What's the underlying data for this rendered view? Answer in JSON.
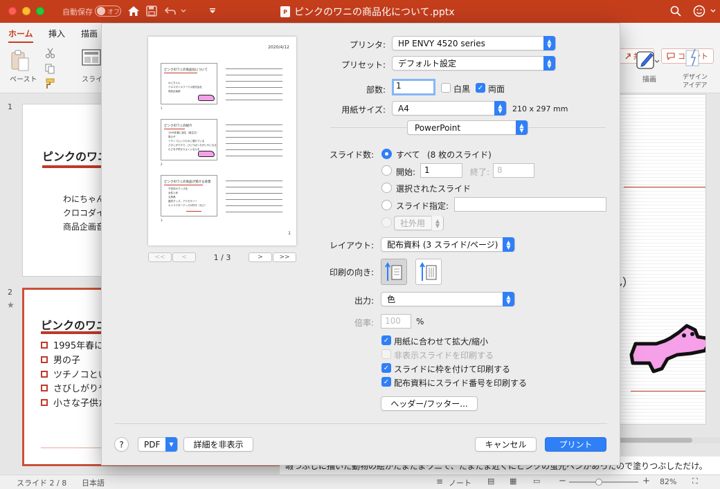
{
  "titlebar": {
    "autosave_label": "自動保存",
    "autosave_state": "オフ",
    "document_title": "ピンクのワニの商品化について.pptx",
    "ppt_badge": "P"
  },
  "ribbon": {
    "tabs": [
      "ホーム",
      "挿入",
      "描画"
    ],
    "share_label": "共有",
    "comment_label": "コメント",
    "paste_label": "ペースト",
    "slide_label": "スライ",
    "draw_label": "描画",
    "design_label_1": "デザイン",
    "design_label_2": "アイデア"
  },
  "thumbnails": {
    "slide1": {
      "number": "1",
      "title": "ピンクのワニ",
      "lines": [
        "わにちゃん",
        "クロコダイ",
        "商品企画音"
      ]
    },
    "slide2": {
      "number": "2",
      "title": "ピンクのワニ",
      "bullets": [
        "1995年春に",
        "男の子",
        "ツチノコとい",
        "さびしがりや",
        "小さな子供た"
      ]
    }
  },
  "mainslide": {
    "partial_text": "ん）"
  },
  "notes": "暇つぶしに描いた動物の絵がたまたまワニで、たまたま近くにピンクの蛍光ペンがあったので塗りつぶしただけ。",
  "status": {
    "slide_counter": "スライド 2 / 8",
    "language": "日本語",
    "notes_label": "ノート",
    "zoom": "82%"
  },
  "preview": {
    "date": "2020/4/12",
    "page_number": "1",
    "page_indicator": "1 / 3",
    "slides": [
      {
        "title": "ピンクのワニの商品化について",
        "lines": [
          "わにちゃん",
          "クロコダイルワークス株式会社",
          "商品企画部"
        ],
        "num": "1"
      },
      {
        "title": "ピンクのワニの紹介",
        "lines": [
          "1995年春に誕生（誕生日）",
          "男の子",
          "ツチノコというものに憧れている",
          "さびしがりやで、ひとりぼっちがいやになる",
          "小さな子供からよくいるんを"
        ],
        "num": "2"
      },
      {
        "title": "ピンクのワニの商品が受ける背景",
        "lines": [
          "子供向けグッズ化",
          "女性人気",
          "文房具",
          "雑貨グッズ、アクセサリー",
          "キャラクターグッズが好き（など）"
        ],
        "num": "3"
      }
    ],
    "nav": {
      "first": "<<",
      "prev": "<",
      "next": ">",
      "last": ">>"
    }
  },
  "print": {
    "printer_label": "プリンタ:",
    "printer_value": "HP ENVY 4520 series",
    "preset_label": "プリセット:",
    "preset_value": "デフォルト設定",
    "copies_label": "部数:",
    "copies_value": "1",
    "bw_label": "白黒",
    "duplex_label": "両面",
    "paper_label": "用紙サイズ:",
    "paper_value": "A4",
    "paper_dims": "210 x 297 mm",
    "app_value": "PowerPoint",
    "slides_label": "スライド数:",
    "all_label": "すべて",
    "all_count": "(8 枚のスライド)",
    "from_label": "開始:",
    "from_value": "1",
    "to_label": "終了:",
    "to_value": "8",
    "selected_label": "選択されたスライド",
    "custom_label": "スライド指定:",
    "custom_value": "",
    "external_value": "社外用",
    "layout_label": "レイアウト:",
    "layout_value": "配布資料 (3 スライド/ページ)",
    "orientation_label": "印刷の向き:",
    "output_label": "出力:",
    "output_value": "色",
    "scale_label": "倍率:",
    "scale_value": "100",
    "scale_unit": "%",
    "fit_label": "用紙に合わせて拡大/縮小",
    "hidden_label": "非表示スライドを印刷する",
    "frame_label": "スライドに枠を付けて印刷する",
    "number_label": "配布資料にスライド番号を印刷する",
    "header_footer_label": "ヘッダー/フッター...",
    "help_label": "?",
    "pdf_label": "PDF",
    "hide_details_label": "詳細を非表示",
    "cancel_label": "キャンセル",
    "print_label": "プリント"
  },
  "colors": {
    "accent_red": "#c43e1c",
    "dialog_blue": "#2f7ff7",
    "croc_pink": "#f5a0e8"
  }
}
